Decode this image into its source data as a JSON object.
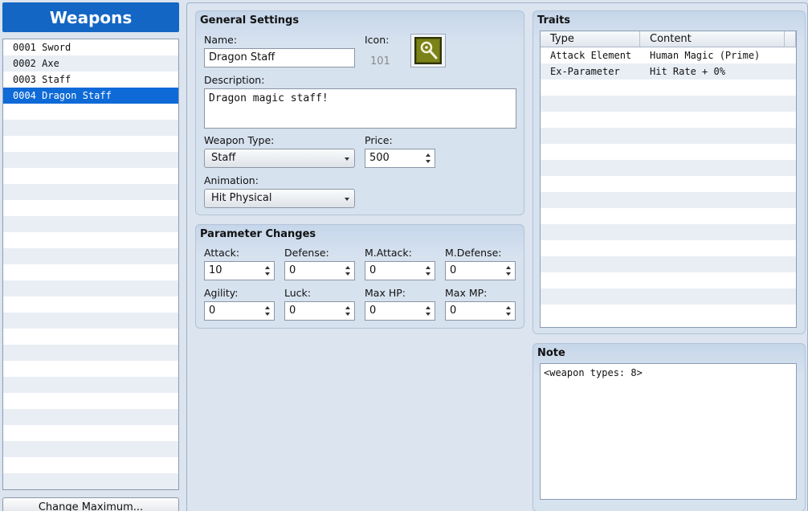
{
  "list": {
    "title": "Weapons",
    "items": [
      {
        "label": "0001 Sword"
      },
      {
        "label": "0002 Axe"
      },
      {
        "label": "0003 Staff"
      },
      {
        "label": "0004 Dragon Staff"
      }
    ],
    "selected_index": 3,
    "change_max_label": "Change Maximum..."
  },
  "general": {
    "title": "General Settings",
    "name_label": "Name:",
    "name_value": "Dragon Staff",
    "icon_label": "Icon:",
    "icon_index": "101",
    "icon_name": "staff-icon",
    "description_label": "Description:",
    "description_value": "Dragon magic staff!",
    "weapon_type_label": "Weapon Type:",
    "weapon_type_value": "Staff",
    "price_label": "Price:",
    "price_value": "500",
    "animation_label": "Animation:",
    "animation_value": "Hit Physical"
  },
  "params": {
    "title": "Parameter Changes",
    "fields": [
      {
        "label": "Attack:",
        "value": "10"
      },
      {
        "label": "Defense:",
        "value": "0"
      },
      {
        "label": "M.Attack:",
        "value": "0"
      },
      {
        "label": "M.Defense:",
        "value": "0"
      },
      {
        "label": "Agility:",
        "value": "0"
      },
      {
        "label": "Luck:",
        "value": "0"
      },
      {
        "label": "Max HP:",
        "value": "0"
      },
      {
        "label": "Max MP:",
        "value": "0"
      }
    ]
  },
  "traits": {
    "title": "Traits",
    "columns": [
      "Type",
      "Content"
    ],
    "rows": [
      {
        "type": "Attack Element",
        "content": "Human Magic (Prime)"
      },
      {
        "type": "Ex-Parameter",
        "content": "Hit Rate + 0%"
      }
    ]
  },
  "note": {
    "title": "Note",
    "value": "<weapon types: 8>"
  },
  "colors": {
    "accent": "#1466c4",
    "selection": "#0e6ad6",
    "panel": "#d7e2ef"
  }
}
